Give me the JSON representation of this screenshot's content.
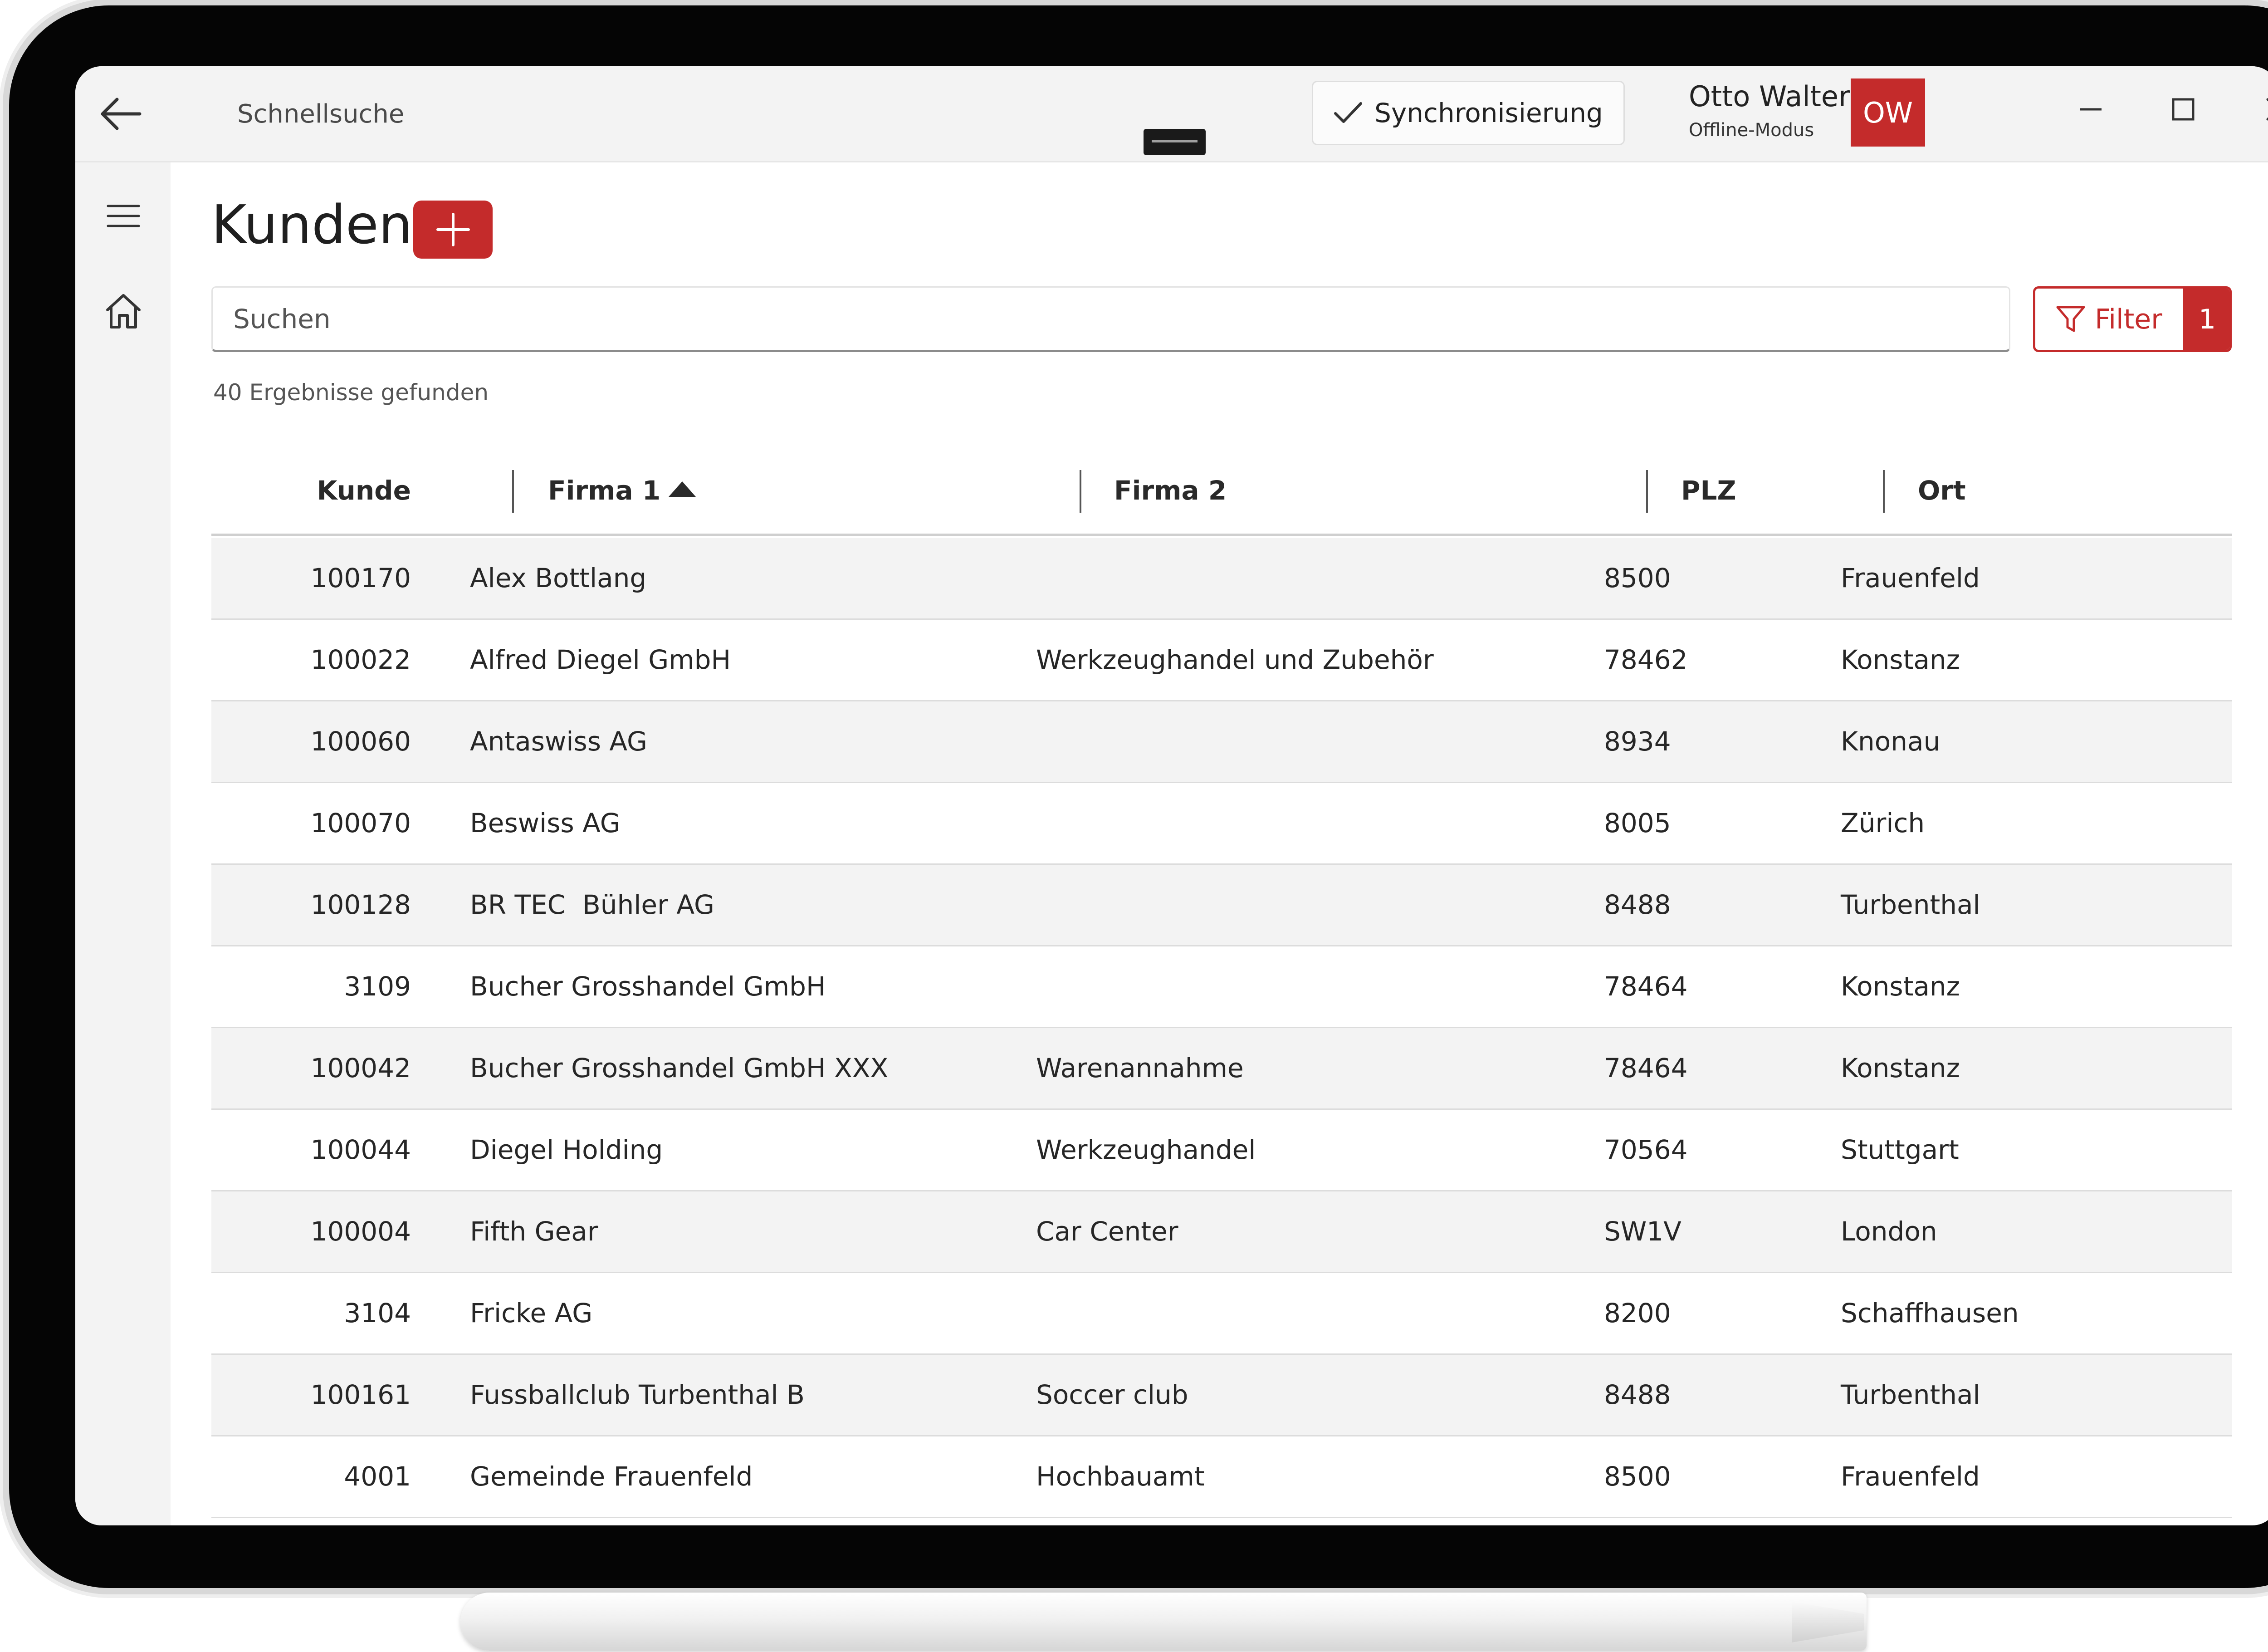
{
  "titlebar": {
    "quicksearch": "Schnellsuche",
    "sync_label": "Synchronisierung",
    "user_name": "Otto Walter",
    "user_mode": "Offline-Modus",
    "avatar_initials": "OW"
  },
  "icons": {
    "back": "back-arrow-icon",
    "menu": "hamburger-icon",
    "home": "home-icon",
    "add": "plus-icon",
    "filter": "funnel-icon",
    "sync": "checkmark-icon",
    "minimize": "minimize-icon",
    "maximize": "maximize-icon",
    "close": "close-icon"
  },
  "colors": {
    "accent": "#c42b2b",
    "chrome": "#f3f3f3",
    "row_alt": "#f3f3f3"
  },
  "page": {
    "title": "Kunden",
    "search_placeholder": "Suchen",
    "filter_label": "Filter",
    "filter_count": "1",
    "results_text": "40 Ergebnisse gefunden"
  },
  "table": {
    "columns": [
      "Kunde",
      "Firma 1",
      "Firma 2",
      "PLZ",
      "Ort"
    ],
    "sort_column": "Firma 1",
    "sort_direction": "ascending",
    "rows": [
      [
        "100170",
        "Alex Bottlang",
        "",
        "8500",
        "Frauenfeld"
      ],
      [
        "100022",
        "Alfred Diegel GmbH",
        "Werkzeughandel und Zubehör",
        "78462",
        "Konstanz"
      ],
      [
        "100060",
        "Antaswiss AG",
        "",
        "8934",
        "Knonau"
      ],
      [
        "100070",
        "Beswiss AG",
        "",
        "8005",
        "Zürich"
      ],
      [
        "100128",
        "BR TEC  Bühler AG",
        "",
        "8488",
        "Turbenthal"
      ],
      [
        "3109",
        "Bucher Grosshandel GmbH",
        "",
        "78464",
        "Konstanz"
      ],
      [
        "100042",
        "Bucher Grosshandel GmbH XXX",
        "Warenannahme",
        "78464",
        "Konstanz"
      ],
      [
        "100044",
        "Diegel Holding",
        "Werkzeughandel",
        "70564",
        "Stuttgart"
      ],
      [
        "100004",
        "Fifth Gear",
        "Car Center",
        "SW1V",
        "London"
      ],
      [
        "3104",
        "Fricke AG",
        "",
        "8200",
        "Schaffhausen"
      ],
      [
        "100161",
        "Fussballclub Turbenthal B",
        "Soccer club",
        "8488",
        "Turbenthal"
      ],
      [
        "4001",
        "Gemeinde Frauenfeld",
        "Hochbauamt",
        "8500",
        "Frauenfeld"
      ]
    ]
  }
}
